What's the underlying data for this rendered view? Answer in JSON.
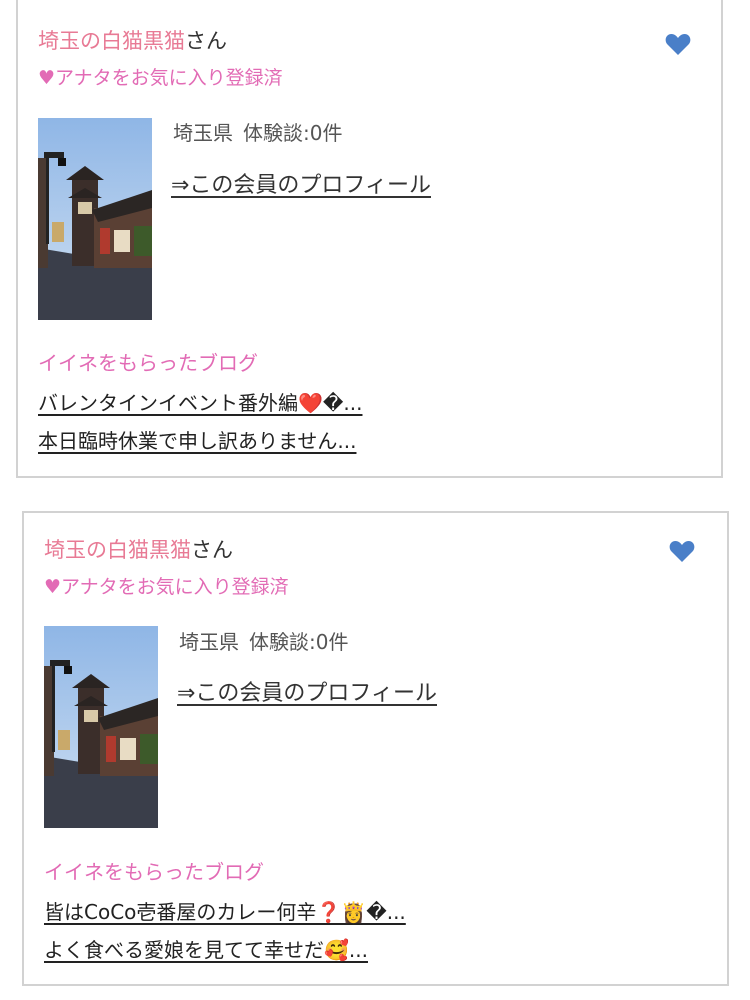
{
  "colors": {
    "name_pink": "#e87a95",
    "accent_pink": "#e26bb5",
    "heart_blue": "#4a7fc8",
    "border": "#d2d2d2"
  },
  "cards": [
    {
      "user_name": "埼玉の白猫黒猫",
      "user_suffix": "さん",
      "favorite_status": "♥アナタをお気に入り登録済",
      "favorite_icon": "heart-icon",
      "region": "埼玉県",
      "experience_count": "体験談:0件",
      "profile_link": "⇒この会員のプロフィール",
      "blog_heading": "イイネをもらったブログ",
      "blogs": [
        "バレンタインイベント番外編❤️�...",
        "本日臨時休業で申し訳ありません..."
      ]
    },
    {
      "user_name": "埼玉の白猫黒猫",
      "user_suffix": "さん",
      "favorite_status": "♥アナタをお気に入り登録済",
      "favorite_icon": "heart-icon",
      "region": "埼玉県",
      "experience_count": "体験談:0件",
      "profile_link": "⇒この会員のプロフィール",
      "blog_heading": "イイネをもらったブログ",
      "blogs": [
        "皆はCoCo壱番屋のカレー何辛❓👸�...",
        "よく食べる愛娘を見てて幸せだ🥰..."
      ]
    }
  ]
}
